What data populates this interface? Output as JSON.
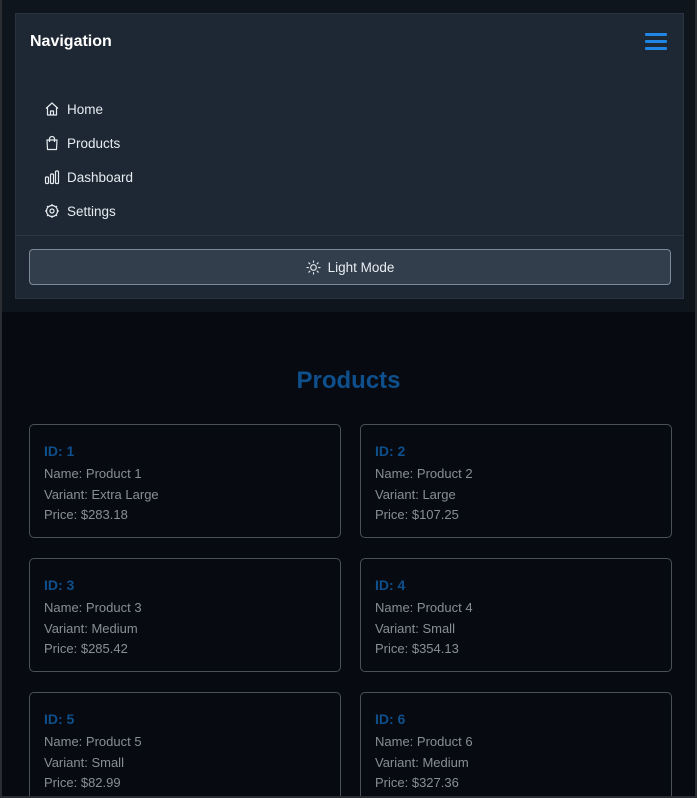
{
  "nav": {
    "title": "Navigation",
    "items": [
      {
        "label": "Home",
        "icon": "home-icon"
      },
      {
        "label": "Products",
        "icon": "shopping-bag-icon"
      },
      {
        "label": "Dashboard",
        "icon": "bar-chart-icon"
      },
      {
        "label": "Settings",
        "icon": "settings-icon"
      }
    ],
    "mode_button": {
      "label": "Light Mode",
      "icon": "sun-icon"
    }
  },
  "main": {
    "title": "Products",
    "products": [
      {
        "id": "ID: 1",
        "name": "Name: Product 1",
        "variant": "Variant: Extra Large",
        "price": "Price: $283.18"
      },
      {
        "id": "ID: 2",
        "name": "Name: Product 2",
        "variant": "Variant: Large",
        "price": "Price: $107.25"
      },
      {
        "id": "ID: 3",
        "name": "Name: Product 3",
        "variant": "Variant: Medium",
        "price": "Price: $285.42"
      },
      {
        "id": "ID: 4",
        "name": "Name: Product 4",
        "variant": "Variant: Small",
        "price": "Price: $354.13"
      },
      {
        "id": "ID: 5",
        "name": "Name: Product 5",
        "variant": "Variant: Small",
        "price": "Price: $82.99"
      },
      {
        "id": "ID: 6",
        "name": "Name: Product 6",
        "variant": "Variant: Medium",
        "price": "Price: $327.36"
      }
    ]
  },
  "colors": {
    "accent": "#1f86e6",
    "card_title": "#0e4f8c",
    "nav_bg": "#1e2834",
    "page_bg": "#070b11"
  }
}
